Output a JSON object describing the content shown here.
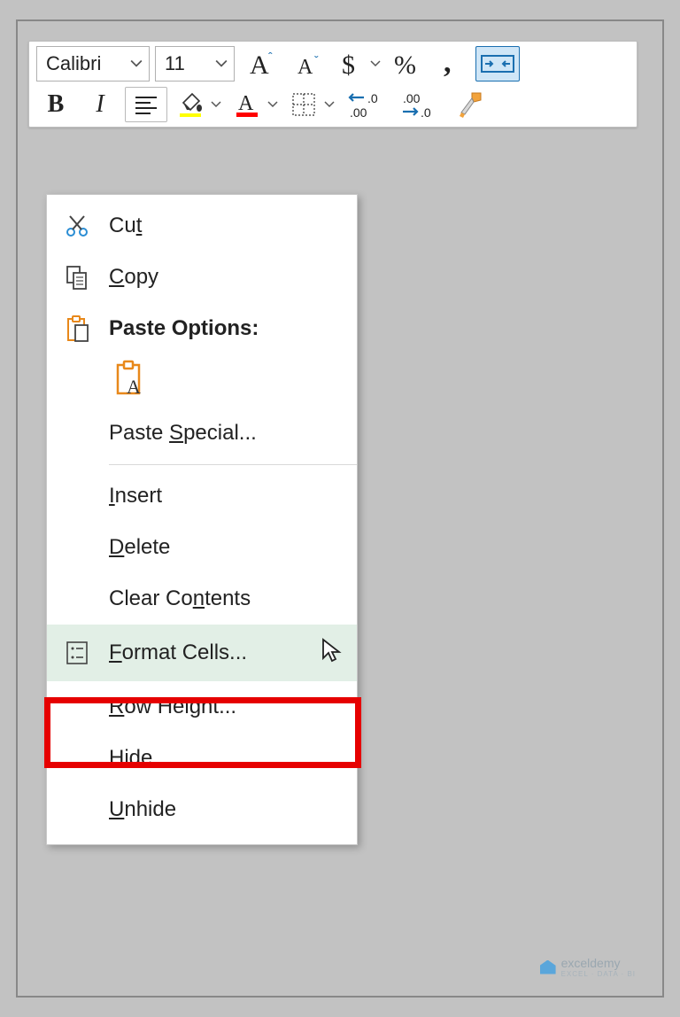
{
  "toolbar": {
    "font_name": "Calibri",
    "font_size": "11"
  },
  "context_menu": {
    "cut": {
      "pre": "Cu",
      "u": "t",
      "post": ""
    },
    "copy": {
      "pre": "",
      "u": "C",
      "post": "opy"
    },
    "paste_options_label": "Paste Options:",
    "paste_special": {
      "pre": "Paste ",
      "u": "S",
      "post": "pecial..."
    },
    "insert": {
      "pre": "",
      "u": "I",
      "post": "nsert"
    },
    "delete": {
      "pre": "",
      "u": "D",
      "post": "elete"
    },
    "clear_contents": {
      "pre": "Clear Co",
      "u": "n",
      "post": "tents"
    },
    "format_cells": {
      "pre": "",
      "u": "F",
      "post": "ormat Cells..."
    },
    "row_height": {
      "pre": "",
      "u": "R",
      "post": "ow Height..."
    },
    "hide": {
      "pre": "",
      "u": "H",
      "post": "ide"
    },
    "unhide": {
      "pre": "",
      "u": "U",
      "post": "nhide"
    }
  },
  "watermark": {
    "brand": "exceldemy",
    "tag": "EXCEL · DATA · BI"
  }
}
